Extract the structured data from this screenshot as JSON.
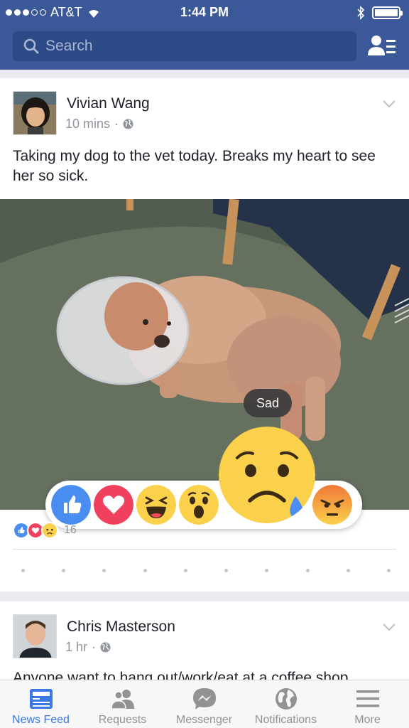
{
  "status_bar": {
    "carrier": "AT&T",
    "time": "1:44 PM"
  },
  "search": {
    "placeholder": "Search"
  },
  "posts": [
    {
      "author": "Vivian Wang",
      "time": "10 mins",
      "text": "Taking my dog to the vet today. Breaks my heart to see her so sick.",
      "reaction_count": "16"
    },
    {
      "author": "Chris Masterson",
      "time": "1 hr",
      "text": "Anyone want to hang out/work/eat at a coffee shop"
    }
  ],
  "reactions": {
    "tooltip": "Sad",
    "items": [
      "like-icon",
      "love-icon",
      "haha-icon",
      "wow-icon",
      "sad-icon",
      "angry-icon"
    ],
    "colors": {
      "like": "#4a8df0",
      "love": "#f0405e",
      "face": "#fbd14b",
      "angry_top": "#f0783a"
    }
  },
  "tabs": [
    {
      "label": "News Feed",
      "icon": "news-feed-icon",
      "active": true
    },
    {
      "label": "Requests",
      "icon": "requests-icon",
      "active": false
    },
    {
      "label": "Messenger",
      "icon": "messenger-icon",
      "active": false
    },
    {
      "label": "Notifications",
      "icon": "notifications-icon",
      "active": false
    },
    {
      "label": "More",
      "icon": "more-icon",
      "active": false
    }
  ],
  "colors": {
    "brand": "#3b5998",
    "active_tab": "#3b78e7"
  }
}
